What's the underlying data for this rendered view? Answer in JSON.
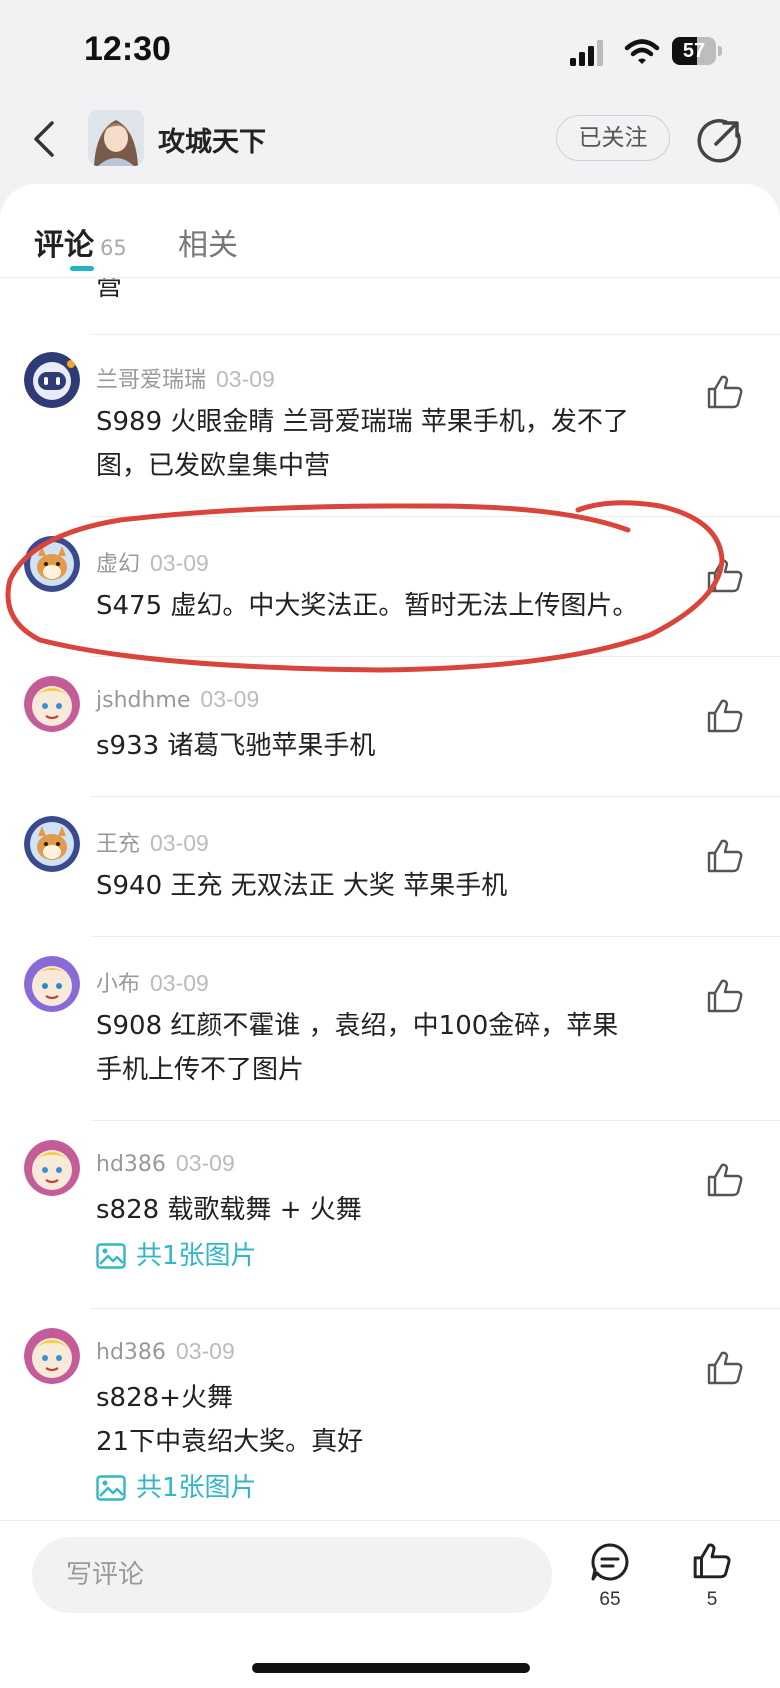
{
  "status_bar": {
    "time": "12:30",
    "battery": "57",
    "battery_level": 0.57
  },
  "header": {
    "title": "攻城天下",
    "follow_label": "已关注"
  },
  "tabs": {
    "comments_label": "评论",
    "comments_count": "65",
    "related_label": "相关"
  },
  "cut_off_text": "营",
  "comments": [
    {
      "user": "兰哥爱瑞瑞",
      "date": "03-09",
      "lines": [
        "S989 火眼金睛 兰哥爱瑞瑞 苹果手机，发不了",
        "图，已发欧皇集中营"
      ],
      "attachment": ""
    },
    {
      "user": "虚幻",
      "date": "03-09",
      "lines": [
        "S475 虚幻。中大奖法正。暂时无法上传图片。"
      ],
      "attachment": ""
    },
    {
      "user": "jshdhme",
      "date": "03-09",
      "lines": [
        "s933 诸葛飞驰苹果手机"
      ],
      "attachment": ""
    },
    {
      "user": "王充",
      "date": "03-09",
      "lines": [
        "S940 王充 无双法正 大奖 苹果手机"
      ],
      "attachment": ""
    },
    {
      "user": "小布",
      "date": "03-09",
      "lines": [
        "S908 红颜不霍谁 ，袁绍，中100金碎，苹果",
        "手机上传不了图片"
      ],
      "attachment": ""
    },
    {
      "user": "hd386",
      "date": "03-09",
      "lines": [
        "s828 载歌载舞 + 火舞"
      ],
      "attachment": "共1张图片"
    },
    {
      "user": "hd386",
      "date": "03-09",
      "lines": [
        "s828+火舞",
        "21下中袁绍大奖。真好"
      ],
      "attachment": "共1张图片"
    }
  ],
  "bottom_bar": {
    "input_placeholder": "写评论",
    "comments_count": "65",
    "likes_count": "5"
  },
  "colors": {
    "accent": "#1fb5c4",
    "link": "#33b7c8",
    "annotation": "#d9453a"
  }
}
